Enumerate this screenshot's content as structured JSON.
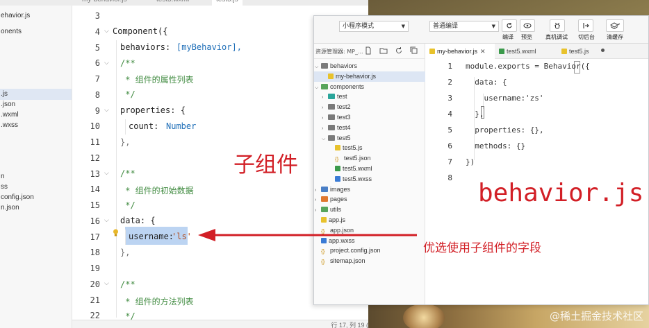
{
  "back_editor": {
    "tabs": [
      "my-behavior.js",
      "test5.wxml",
      "test5.js"
    ],
    "sidebar": [
      "ehavior.js",
      "onents",
      "",
      "",
      "",
      "",
      "",
      "",
      ".js",
      ".json",
      ".wxml",
      ".wxss",
      "",
      "",
      "",
      "n",
      "ss",
      "config.json",
      "n.json"
    ],
    "line_numbers": [
      "3",
      "4",
      "5",
      "6",
      "7",
      "8",
      "9",
      "10",
      "11",
      "12",
      "13",
      "14",
      "15",
      "16",
      "17",
      "18",
      "19",
      "20",
      "21",
      "22"
    ],
    "code": {
      "l4": "Component({",
      "l5_key": "behaviors: ",
      "l5_val": "[myBehavior],",
      "l6": "/**",
      "l7": " * 组件的属性列表",
      "l8": " */",
      "l9": "properties: {",
      "l10_key": "count: ",
      "l10_val": "Number",
      "l11": "},",
      "l13": "/**",
      "l14": " * 组件的初始数据",
      "l15": " */",
      "l16": "data: {",
      "l17_key": "username: ",
      "l17_val": "'ls'",
      "l18": "},",
      "l20": "/**",
      "l21": " * 组件的方法列表",
      "l22": " */"
    },
    "status": "行 17, 列 19 ("
  },
  "front_window": {
    "toolbar": {
      "mode_select": "小程序模式",
      "compile_select": "普通编译",
      "buttons": [
        {
          "label": "编译",
          "icon": "refresh-icon"
        },
        {
          "label": "预览",
          "icon": "eye-icon"
        },
        {
          "label": "真机调试",
          "icon": "debug-icon"
        },
        {
          "label": "切后台",
          "icon": "switch-icon"
        },
        {
          "label": "清缓存",
          "icon": "layers-icon"
        }
      ]
    },
    "tree_title": "资源管理器: MP_...",
    "tree": [
      {
        "label": "behaviors",
        "indent": 0,
        "type": "folder",
        "expanded": true
      },
      {
        "label": "my-behavior.js",
        "indent": 1,
        "type": "js",
        "selected": true
      },
      {
        "label": "components",
        "indent": 0,
        "type": "folder-g",
        "expanded": true
      },
      {
        "label": "test",
        "indent": 1,
        "type": "folder-t"
      },
      {
        "label": "test2",
        "indent": 1,
        "type": "folder"
      },
      {
        "label": "test3",
        "indent": 1,
        "type": "folder"
      },
      {
        "label": "test4",
        "indent": 1,
        "type": "folder"
      },
      {
        "label": "test5",
        "indent": 1,
        "type": "folder",
        "expanded": true
      },
      {
        "label": "test5.js",
        "indent": 2,
        "type": "js"
      },
      {
        "label": "test5.json",
        "indent": 2,
        "type": "json"
      },
      {
        "label": "test5.wxml",
        "indent": 2,
        "type": "wxml"
      },
      {
        "label": "test5.wxss",
        "indent": 2,
        "type": "wxss"
      },
      {
        "label": "images",
        "indent": 0,
        "type": "folder-b"
      },
      {
        "label": "pages",
        "indent": 0,
        "type": "folder-o"
      },
      {
        "label": "utils",
        "indent": 0,
        "type": "folder-g"
      },
      {
        "label": "app.js",
        "indent": 0,
        "type": "js"
      },
      {
        "label": "app.json",
        "indent": 0,
        "type": "json"
      },
      {
        "label": "app.wxss",
        "indent": 0,
        "type": "wxss"
      },
      {
        "label": "project.config.json",
        "indent": 0,
        "type": "json"
      },
      {
        "label": "sitemap.json",
        "indent": 0,
        "type": "json"
      }
    ],
    "editor_tabs": [
      {
        "label": "my-behavior.js",
        "type": "js",
        "active": true
      },
      {
        "label": "test5.wxml",
        "type": "wxml"
      },
      {
        "label": "test5.js",
        "type": "js"
      }
    ],
    "line_numbers": [
      "1",
      "2",
      "3",
      "4",
      "5",
      "6",
      "7",
      "8"
    ],
    "code": {
      "l1": "module.exports = Behavior({",
      "l2": "  data: {",
      "l3_key": "    username: ",
      "l3_val": "'zs'",
      "l4": "  },",
      "l5": "  properties: {},",
      "l6": "  methods: {}",
      "l7": "})"
    }
  },
  "annotations": {
    "sub_component": "子组件",
    "behavior_file": "behavior.js",
    "prefer": "优选使用子组件的字段"
  },
  "watermark": "@稀土掘金技术社区",
  "colors": {
    "annotation_red": "#d21f26",
    "selection_blue": "#bcd4f2",
    "comment_green": "#3f8a3f"
  }
}
